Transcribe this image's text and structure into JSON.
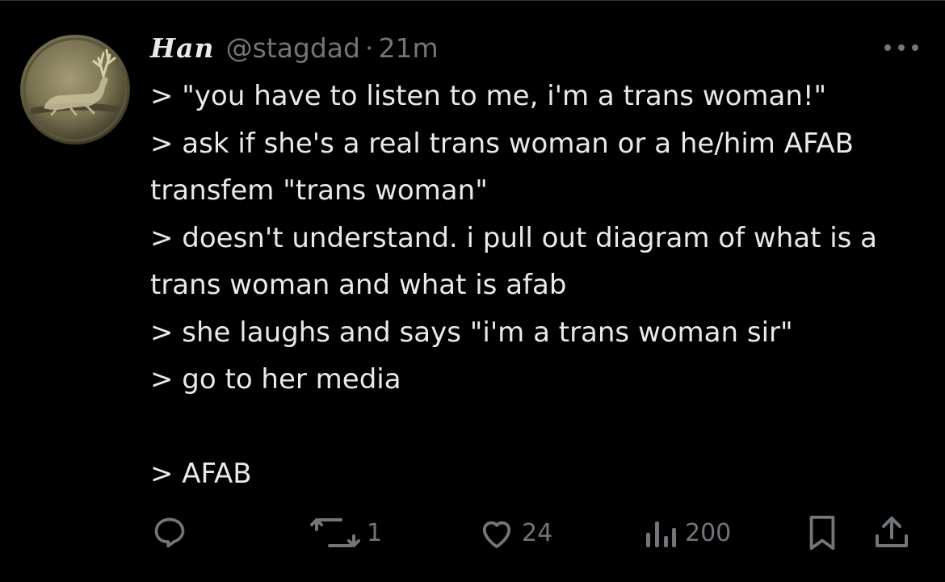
{
  "tweet": {
    "display_name": "Han",
    "handle": "@stagdad",
    "separator": "·",
    "time": "21m",
    "lines": [
      "> \"you have to listen to me, i'm a trans woman!\"",
      "> ask if she's a real trans woman or a he/him AFAB transfem \"trans woman\"",
      "> doesn't understand. i pull out diagram of what is a trans woman and what is afab",
      "> she laughs and says \"i'm a trans woman sir\"",
      "> go to her media",
      "",
      "> AFAB"
    ]
  },
  "actions": {
    "reply": {
      "icon": "reply-icon",
      "count": ""
    },
    "repost": {
      "icon": "repost-icon",
      "count": "1"
    },
    "like": {
      "icon": "heart-icon",
      "count": "24"
    },
    "views": {
      "icon": "views-icon",
      "count": "200"
    },
    "bookmark": {
      "icon": "bookmark-icon"
    },
    "share": {
      "icon": "share-icon"
    }
  },
  "colors": {
    "background": "#000000",
    "text": "#e7e9ea",
    "secondary": "#71767b",
    "divider": "#2f3336"
  },
  "avatar": {
    "icon": "stag-medallion-icon"
  },
  "more": {
    "icon": "more-dots-icon"
  }
}
